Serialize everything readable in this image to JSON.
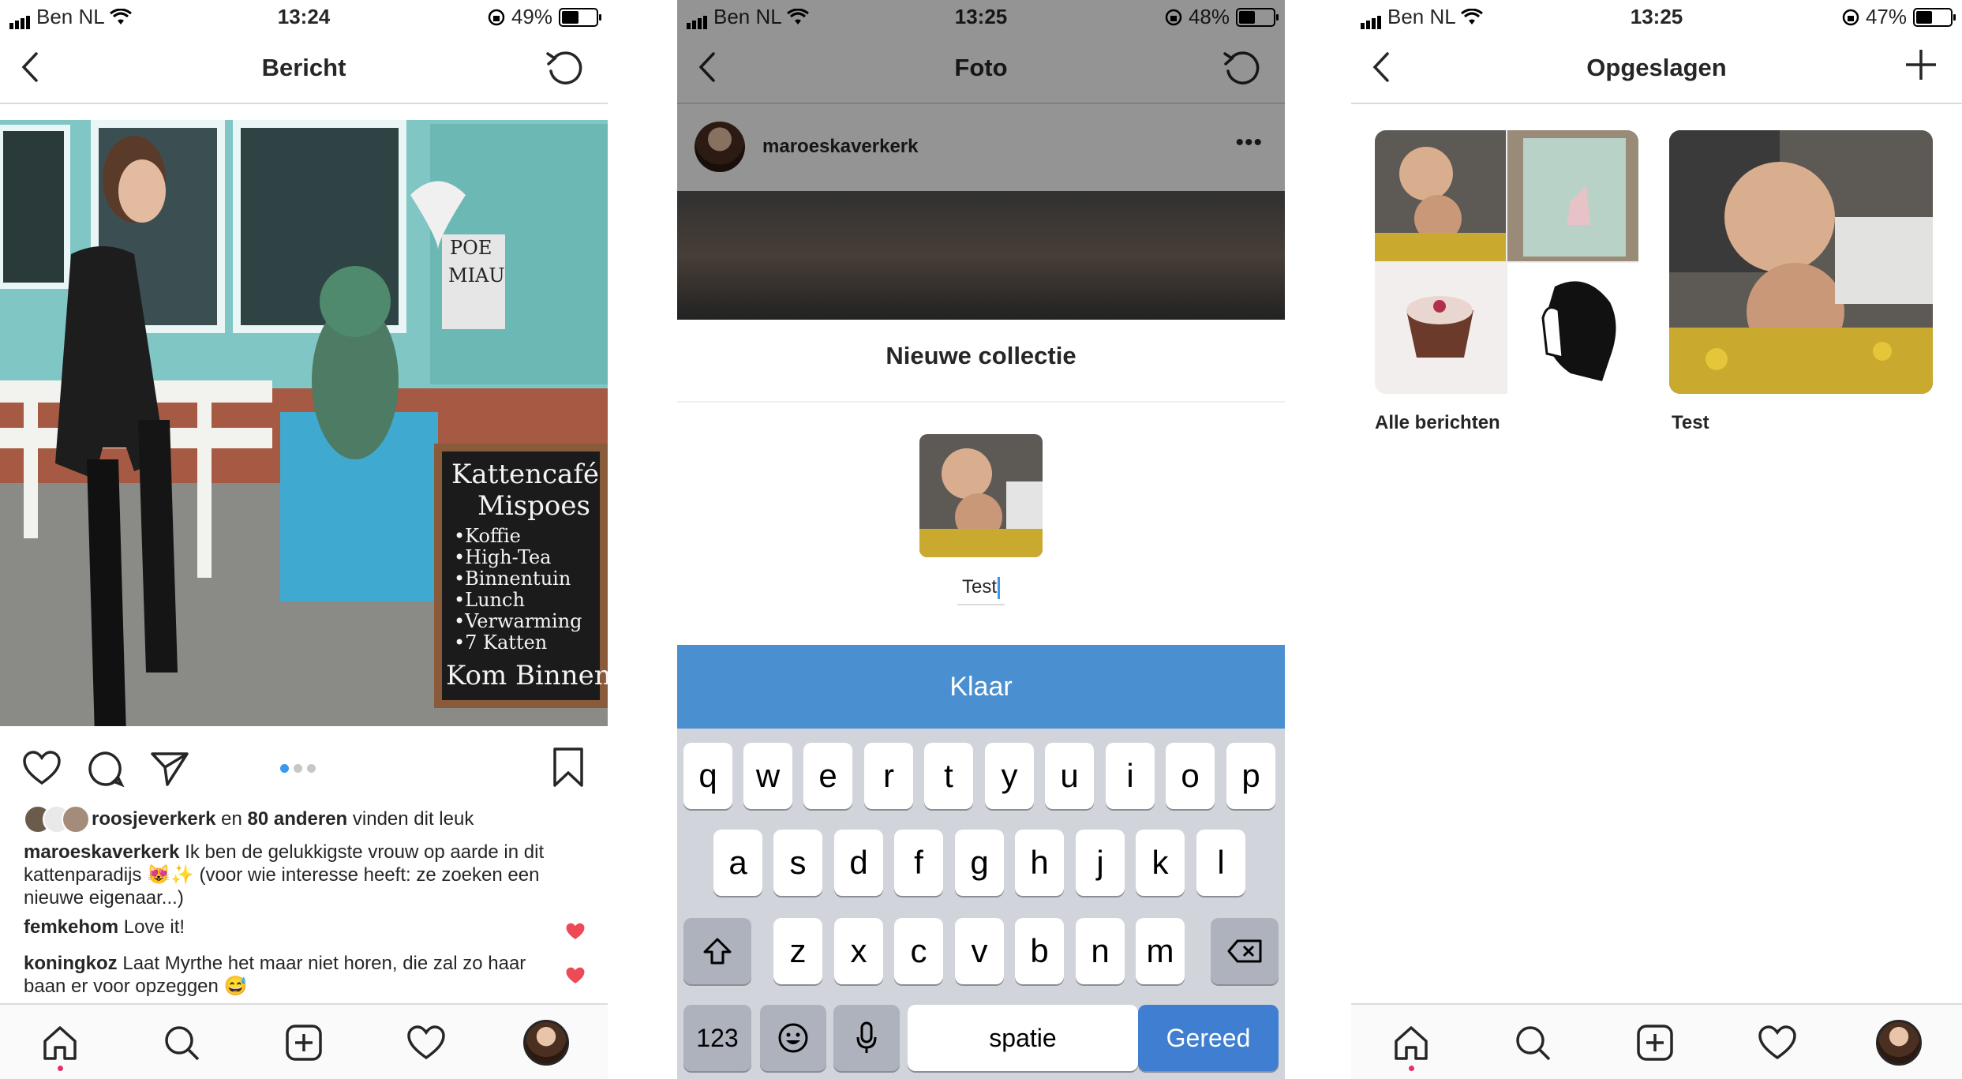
{
  "screens": [
    {
      "status": {
        "carrier": "Ben NL",
        "time": "13:24",
        "battery": "49%",
        "battery_level": 0.49
      },
      "nav": {
        "title": "Bericht"
      },
      "post": {
        "likes": {
          "user": "roosjeverkerk",
          "middle": " en ",
          "others": "80 anderen",
          "suffix": " vinden dit leuk"
        },
        "caption": {
          "user": "maroeskaverkerk",
          "text": " Ik ben de gelukkigste vrouw op aarde in dit kattenparadijs 😻✨ (voor wie interesse heeft: ze zoeken een nieuwe eigenaar...)"
        },
        "comments": [
          {
            "user": "femkehom",
            "text": " Love it!"
          },
          {
            "user": "koningkoz",
            "text": " Laat Myrthe het maar niet horen, die zal zo haar baan er voor opzeggen 😅"
          }
        ],
        "carousel": {
          "count": 3,
          "active": 1
        },
        "sign_lines": [
          "Kattencafé",
          "Mispoes",
          "•Koffie",
          "•High-Tea",
          "•Binnentuin",
          "•Lunch",
          "•Verwarming",
          "•7 Katten",
          "Kom Binnen!"
        ],
        "window_sign": [
          "POE",
          "MIAU"
        ]
      },
      "colors": {
        "heart": "#ed4956",
        "dot_active": "#3897f0"
      }
    },
    {
      "status": {
        "carrier": "Ben NL",
        "time": "13:25",
        "battery": "48%",
        "battery_level": 0.48
      },
      "nav": {
        "title": "Foto"
      },
      "post": {
        "username": "maroeskaverkerk",
        "more": "•••"
      },
      "modal": {
        "title": "Nieuwe collectie",
        "input_value": "Test",
        "done": "Klaar"
      },
      "keyboard": {
        "row1": [
          "q",
          "w",
          "e",
          "r",
          "t",
          "y",
          "u",
          "i",
          "o",
          "p"
        ],
        "row2": [
          "a",
          "s",
          "d",
          "f",
          "g",
          "h",
          "j",
          "k",
          "l"
        ],
        "row3": [
          "z",
          "x",
          "c",
          "v",
          "b",
          "n",
          "m"
        ],
        "numbers": "123",
        "space": "spatie",
        "return": "Gereed"
      },
      "colors": {
        "done_bar": "#4a8fd0",
        "return_key": "#3f7ed0"
      }
    },
    {
      "status": {
        "carrier": "Ben NL",
        "time": "13:25",
        "battery": "47%",
        "battery_level": 0.47
      },
      "nav": {
        "title": "Opgeslagen"
      },
      "collections": [
        {
          "name": "Alle berichten"
        },
        {
          "name": "Test"
        }
      ]
    }
  ]
}
